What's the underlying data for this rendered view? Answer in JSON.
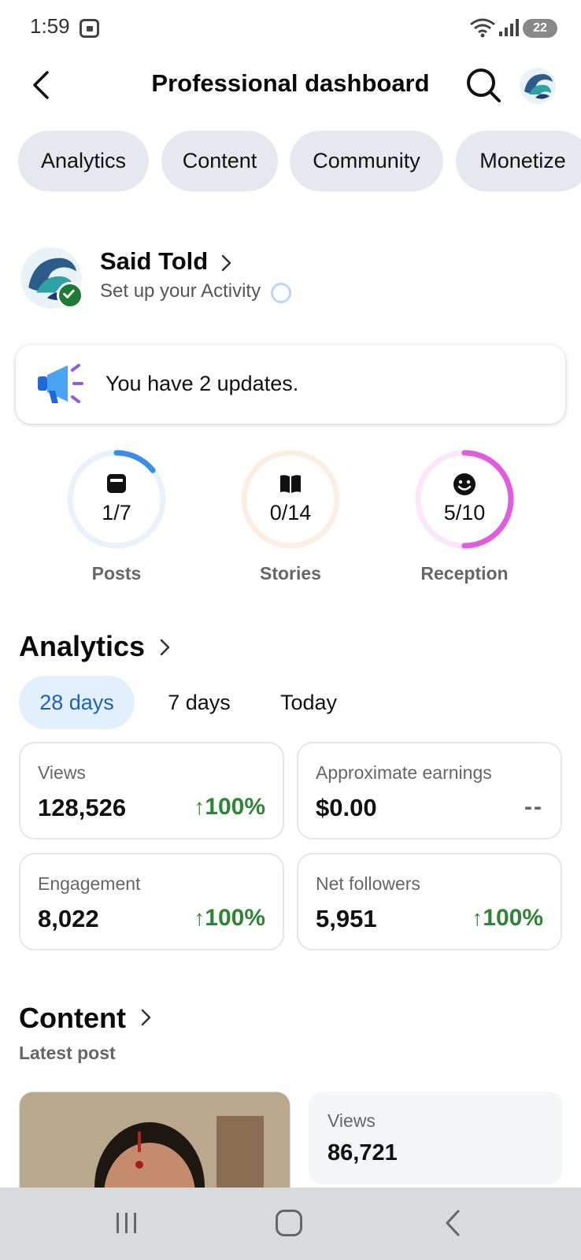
{
  "status_bar": {
    "time": "1:59",
    "battery": "22"
  },
  "header": {
    "title": "Professional dashboard"
  },
  "tabs": [
    {
      "label": "Analytics"
    },
    {
      "label": "Content"
    },
    {
      "label": "Community"
    },
    {
      "label": "Monetize"
    }
  ],
  "profile": {
    "name": "Said Told",
    "subtitle": "Set up your Activity"
  },
  "updates": {
    "text": "You have 2 updates."
  },
  "progress": [
    {
      "value": "1/7",
      "label": "Posts",
      "fraction": 0.143,
      "color": "#3b8ded",
      "track": "#e8f2fd",
      "icon": "post-icon"
    },
    {
      "value": "0/14",
      "label": "Stories",
      "fraction": 0,
      "color": "#f5a25a",
      "track": "#fdeee2",
      "icon": "book-icon"
    },
    {
      "value": "5/10",
      "label": "Reception",
      "fraction": 0.5,
      "color": "#e25ce0",
      "track": "#fbe6fb",
      "icon": "smile-icon"
    }
  ],
  "analytics": {
    "title": "Analytics",
    "ranges": [
      {
        "label": "28 days"
      },
      {
        "label": "7 days"
      },
      {
        "label": "Today"
      }
    ],
    "metrics": [
      {
        "label": "Views",
        "value": "128,526",
        "change": "100%"
      },
      {
        "label": "Approximate earnings",
        "value": "$0.00",
        "change": "--"
      },
      {
        "label": "Engagement",
        "value": "8,022",
        "change": "100%"
      },
      {
        "label": "Net followers",
        "value": "5,951",
        "change": "100%"
      }
    ]
  },
  "content": {
    "title": "Content",
    "subtitle": "Latest post",
    "latest_post": {
      "views_label": "Views",
      "views_value": "86,721"
    }
  },
  "colors": {
    "accent": "#1c63b8",
    "positive": "#2e8535",
    "verified": "#1f7a36"
  }
}
